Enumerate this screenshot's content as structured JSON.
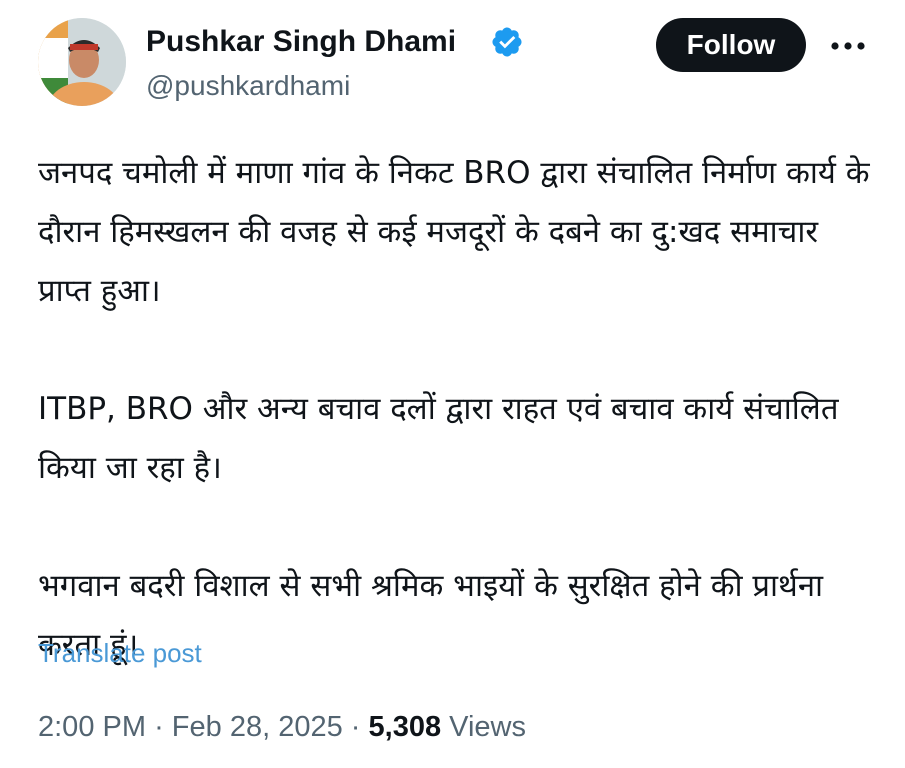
{
  "author": {
    "display_name": "Pushkar Singh Dhami",
    "handle": "@pushkardhami",
    "verified": true,
    "avatar_icon": "profile-photo"
  },
  "actions": {
    "follow_label": "Follow",
    "more_icon": "more-horizontal-icon"
  },
  "tweet": {
    "paragraphs": [
      "जनपद चमोली में माणा गांव के निकट BRO द्वारा संचालित निर्माण कार्य के दौरान हिमस्खलन की वजह से कई मजदूरों के दबने का दु:खद समाचार प्राप्त हुआ।",
      "ITBP, BRO और अन्य बचाव दलों द्वारा राहत एवं बचाव कार्य संचालित किया जा रहा है।",
      "भगवान बदरी विशाल से सभी श्रमिक भाइयों के सुरक्षित होने की प्रार्थना करता हूं।"
    ],
    "translate_label": "Translate post"
  },
  "meta": {
    "time": "2:00 PM",
    "separator": "·",
    "date": "Feb 28, 2025",
    "views_count": "5,308",
    "views_label": "Views"
  },
  "colors": {
    "verified_badge": "#1d9bf0",
    "link": "#4a99d6",
    "secondary_text": "#536471",
    "primary_text": "#0f1419",
    "button_bg": "#0f1419"
  }
}
